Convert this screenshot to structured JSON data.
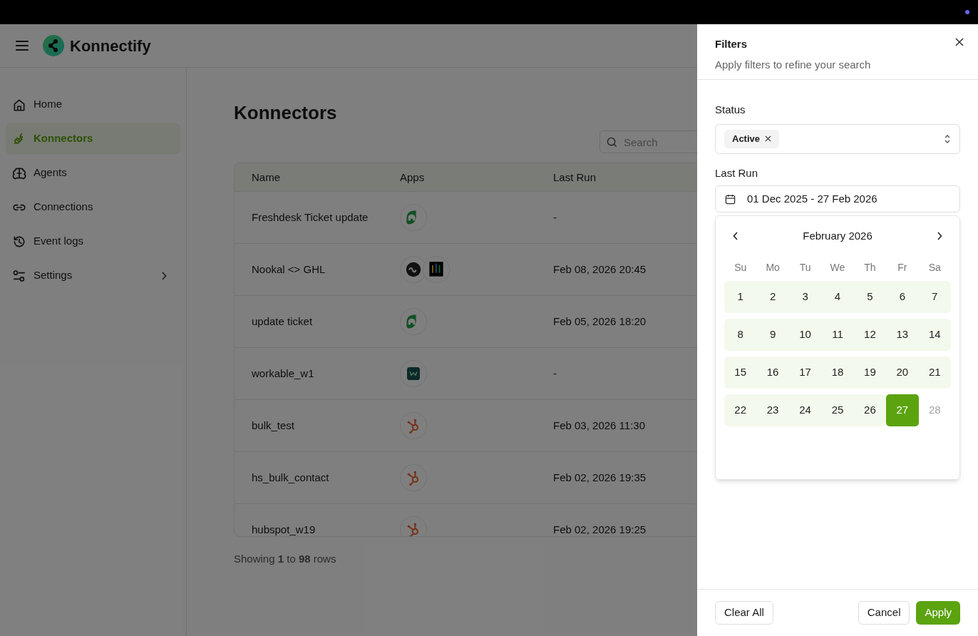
{
  "brand": {
    "name": "Konnectify"
  },
  "sidebar": {
    "items": [
      {
        "label": "Home",
        "selected": false
      },
      {
        "label": "Konnectors",
        "selected": true
      },
      {
        "label": "Agents",
        "selected": false
      },
      {
        "label": "Connections",
        "selected": false
      },
      {
        "label": "Event logs",
        "selected": false
      },
      {
        "label": "Settings",
        "selected": false,
        "expandable": true
      }
    ]
  },
  "page": {
    "title": "Konnectors",
    "search": {
      "placeholder": "Search"
    }
  },
  "table": {
    "columns": [
      "Name",
      "Apps",
      "Last Run"
    ],
    "rows": [
      {
        "name": "Freshdesk Ticket update",
        "apps": [
          {
            "kind": "headset"
          }
        ],
        "last_run": "-"
      },
      {
        "name": "Nookal <> GHL",
        "apps": [
          {
            "kind": "wave"
          },
          {
            "kind": "bars"
          }
        ],
        "last_run": "Feb 08, 2026 20:45"
      },
      {
        "name": "update ticket",
        "apps": [
          {
            "kind": "headset"
          }
        ],
        "last_run": "Feb 05, 2026 18:20"
      },
      {
        "name": "workable_w1",
        "apps": [
          {
            "kind": "workable"
          }
        ],
        "last_run": "-"
      },
      {
        "name": "bulk_test",
        "apps": [
          {
            "kind": "sprocket"
          }
        ],
        "last_run": "Feb 03, 2026 11:30"
      },
      {
        "name": "hs_bulk_contact",
        "apps": [
          {
            "kind": "sprocket"
          }
        ],
        "last_run": "Feb 02, 2026 19:35"
      },
      {
        "name": "hubspot_w19",
        "apps": [
          {
            "kind": "sprocket"
          }
        ],
        "last_run": "Feb 02, 2026 19:25"
      }
    ],
    "footer": "Showing **1** to **98** rows"
  },
  "filters": {
    "title": "Filters",
    "subtitle": "Apply filters to refine your search",
    "status": {
      "label": "Status",
      "chips": [
        "Active"
      ]
    },
    "last_run": {
      "label": "Last Run",
      "value": "01 Dec 2025 - 27 Feb 2026"
    },
    "calendar": {
      "month": "February 2026",
      "weekdays": [
        "Su",
        "Mo",
        "Tu",
        "We",
        "Th",
        "Fr",
        "Sa"
      ],
      "weeks": [
        [
          {
            "day": "1",
            "kind": "range"
          },
          {
            "day": "2",
            "kind": "range"
          },
          {
            "day": "3",
            "kind": "range"
          },
          {
            "day": "4",
            "kind": "range"
          },
          {
            "day": "5",
            "kind": "range"
          },
          {
            "day": "6",
            "kind": "range"
          },
          {
            "day": "7",
            "kind": "range"
          }
        ],
        [
          {
            "day": "8",
            "kind": "range"
          },
          {
            "day": "9",
            "kind": "range"
          },
          {
            "day": "10",
            "kind": "range"
          },
          {
            "day": "11",
            "kind": "range"
          },
          {
            "day": "12",
            "kind": "range"
          },
          {
            "day": "13",
            "kind": "range"
          },
          {
            "day": "14",
            "kind": "range"
          }
        ],
        [
          {
            "day": "15",
            "kind": "range"
          },
          {
            "day": "16",
            "kind": "range"
          },
          {
            "day": "17",
            "kind": "range"
          },
          {
            "day": "18",
            "kind": "range"
          },
          {
            "day": "19",
            "kind": "range"
          },
          {
            "day": "20",
            "kind": "range"
          },
          {
            "day": "21",
            "kind": "range"
          }
        ],
        [
          {
            "day": "22",
            "kind": "range"
          },
          {
            "day": "23",
            "kind": "range"
          },
          {
            "day": "24",
            "kind": "range"
          },
          {
            "day": "25",
            "kind": "range"
          },
          {
            "day": "26",
            "kind": "range"
          },
          {
            "day": "27",
            "kind": "selected"
          },
          {
            "day": "28",
            "kind": "disabled"
          }
        ]
      ]
    },
    "buttons": {
      "clear": "Clear All",
      "cancel": "Cancel",
      "apply": "Apply"
    }
  }
}
